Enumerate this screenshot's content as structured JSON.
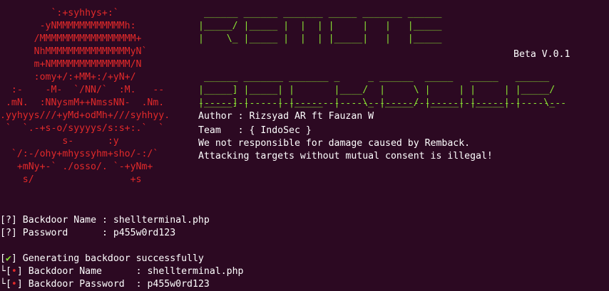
{
  "terminal": {
    "logo_art": "         `:+syhhys+:`\n       -yNMMMMMMMMMMMMh:\n      /MMMMMMMMMMMMMMMMM+\n      NhMMMMMMMMMMMMMMMyN`\n      m+NMMMMMMMMMMMMMM/N\n      :omy+/:+MM+:/+yN+/\n  :-    -M-  `/NN/`  :M.   --\n .mN.  :NNysmM++NmssNN-  .Nm.\n.yyhyys///+yMd+odMh+///syhhyy.\n `  `.-+s-o/syyyys/s:s+:.`  `\n           s-      :y\n  `/:-/ohy+mhyssyhm+sho/-:/`\n   +mNy+-` ./osso/. `-+yNm+\n    s/                 +s",
    "title_art": " ______ ______ _______ _____ _______ ______\n|_____/ |_____ |  |  | |     |   |   |_____\n|    \\_ |_____ |  |  | |_____|   |   |_____\n\n\n ______ _______ _______ _     _ ______  _____   _____   ______\n|_____] |_____| |       |____/  |     \\ |     | |     | |_____/\n|_____] |     | |_____  |    \\_ |_____/ |_____| |_____| |    \\_",
    "beta_label": "Beta V.0.1",
    "divider": "-----------------------------------------------------------------",
    "author_line": "Author : Rizsyad AR ft Fauzan W",
    "team_line": "Team   : { IndoSec }",
    "disclaimer_line": "We not responsible for damage caused by Remback.",
    "warning_line": "Attacking targets without mutual consent is illegal!",
    "prompts": [
      {
        "bracket_open": "[",
        "mark": "?",
        "bracket_close": "]",
        "text": " Backdoor Name : shellterminal.php"
      },
      {
        "bracket_open": "[",
        "mark": "?",
        "bracket_close": "]",
        "text": " Password      : p455w0rd123"
      }
    ],
    "status": {
      "bracket_open": "[",
      "mark": "✔",
      "bracket_close": "]",
      "text": " Generating backdoor successfully"
    },
    "results": [
      {
        "tree": "└",
        "bracket_open": "[",
        "mark": "•",
        "bracket_close": "]",
        "text": " Backdoor Name      : shellterminal.php"
      },
      {
        "tree": "└",
        "bracket_open": "[",
        "mark": "•",
        "bracket_close": "]",
        "text": " Backdoor Password  : p455w0rd123"
      }
    ]
  },
  "colors": {
    "background": "#2c0922",
    "logo_red": "#e32a2a",
    "title_green": "#8ae234",
    "text_white": "#ffffff"
  }
}
